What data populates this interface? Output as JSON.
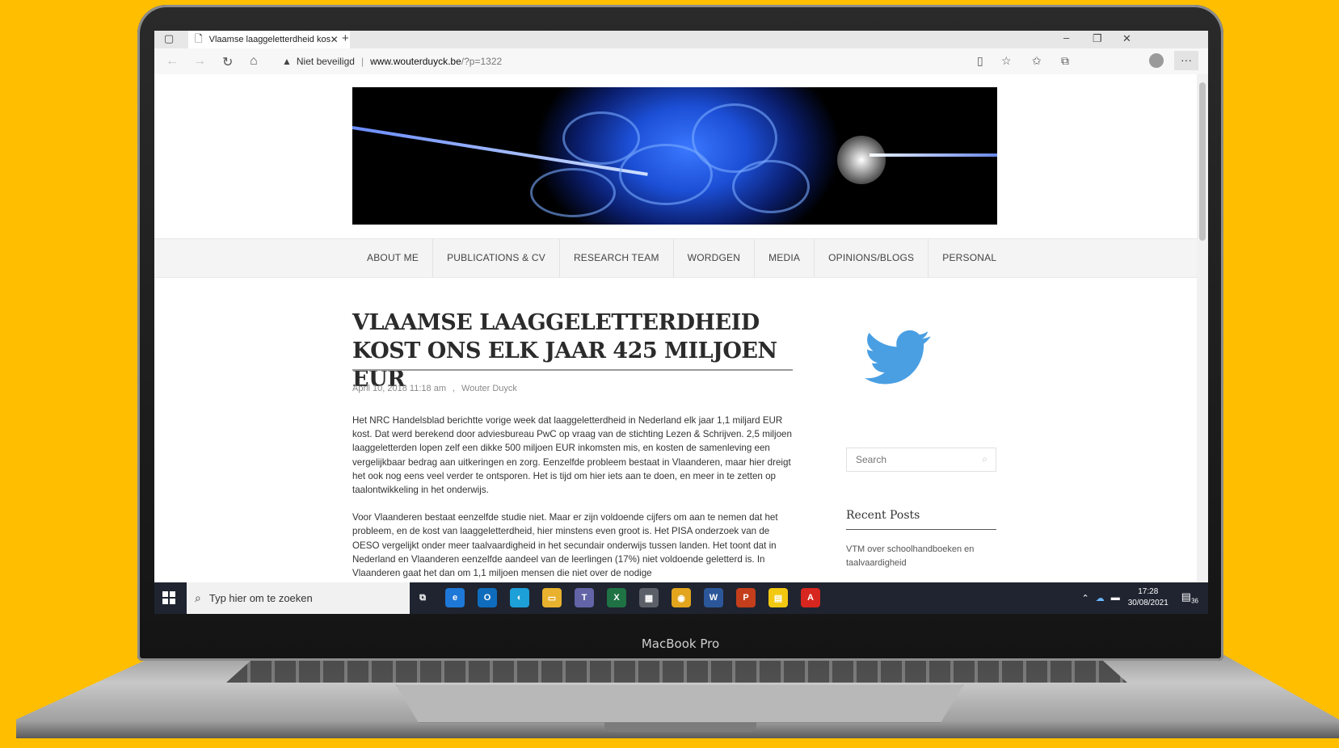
{
  "laptop": {
    "brand": "MacBook Pro"
  },
  "browser": {
    "tab_title": "Vlaamse laaggeletterdheid kost",
    "security_label": "Niet beveiligd",
    "url_host": "www.wouterduyck.be",
    "url_path": "/?p=1322"
  },
  "site": {
    "nav": [
      "ABOUT ME",
      "PUBLICATIONS & CV",
      "RESEARCH TEAM",
      "WORDGEN",
      "MEDIA",
      "OPINIONS/BLOGS",
      "PERSONAL"
    ],
    "post": {
      "title": "VLAAMSE LAAGGELETTERDHEID KOST ONS ELK JAAR 425 MILJOEN EUR",
      "date": "April 10, 2018 11:18 am",
      "separator": ",",
      "author": "Wouter Duyck",
      "paragraphs": [
        "Het NRC Handelsblad berichtte vorige week dat laaggeletterdheid in Nederland elk jaar 1,1 miljard EUR kost. Dat werd berekend door adviesbureau PwC op vraag van de stichting Lezen & Schrijven. 2,5 miljoen laaggeletterden lopen zelf een dikke 500 miljoen EUR inkomsten mis, en kosten de samenleving een vergelijkbaar bedrag aan uitkeringen en zorg. Eenzelfde probleem bestaat in Vlaanderen, maar hier dreigt het ook nog eens veel verder te ontsporen. Het is tijd om hier iets aan te doen, en meer in te zetten op taalontwikkeling in het onderwijs.",
        "Voor Vlaanderen bestaat eenzelfde studie niet. Maar er zijn voldoende cijfers om aan te nemen dat het probleem, en de kost van laaggeletterdheid, hier minstens even groot is. Het PISA onderzoek van de OESO vergelijkt onder meer taalvaardigheid in het secundair onderwijs tussen landen. Het toont dat in Nederland en Vlaanderen eenzelfde aandeel van de leerlingen (17%) niet voldoende geletterd is. In Vlaanderen gaat het dan om 1,1 miljoen mensen die niet over de nodige"
      ]
    },
    "sidebar": {
      "search_placeholder": "Search",
      "recent_posts_title": "Recent Posts",
      "recent_posts": [
        "VTM over schoolhandboeken en taalvaardigheid"
      ]
    }
  },
  "taskbar": {
    "search_placeholder": "Typ hier om te zoeken",
    "time": "17:28",
    "date": "30/08/2021",
    "notification_count": "36",
    "apps": [
      {
        "name": "task-view",
        "color": "#1f2430",
        "glyph": "⧉"
      },
      {
        "name": "internet-explorer",
        "color": "#1e78d7",
        "glyph": "e"
      },
      {
        "name": "outlook",
        "color": "#0f6cbd",
        "glyph": "O"
      },
      {
        "name": "edge",
        "color": "#1d9fd8",
        "glyph": "◐"
      },
      {
        "name": "file-explorer",
        "color": "#e8b12e",
        "glyph": "▭"
      },
      {
        "name": "teams",
        "color": "#6264a7",
        "glyph": "T"
      },
      {
        "name": "excel",
        "color": "#1f7244",
        "glyph": "X"
      },
      {
        "name": "calculator",
        "color": "#5b6068",
        "glyph": "▦"
      },
      {
        "name": "chrome",
        "color": "#e2a51d",
        "glyph": "◉"
      },
      {
        "name": "word",
        "color": "#2b579a",
        "glyph": "W"
      },
      {
        "name": "powerpoint",
        "color": "#c43e1c",
        "glyph": "P"
      },
      {
        "name": "sticky-notes",
        "color": "#f2c811",
        "glyph": "▤"
      },
      {
        "name": "acrobat",
        "color": "#d7261f",
        "glyph": "A"
      }
    ]
  },
  "colors": {
    "background": "#ffbf00",
    "twitter": "#4a9fe3"
  }
}
